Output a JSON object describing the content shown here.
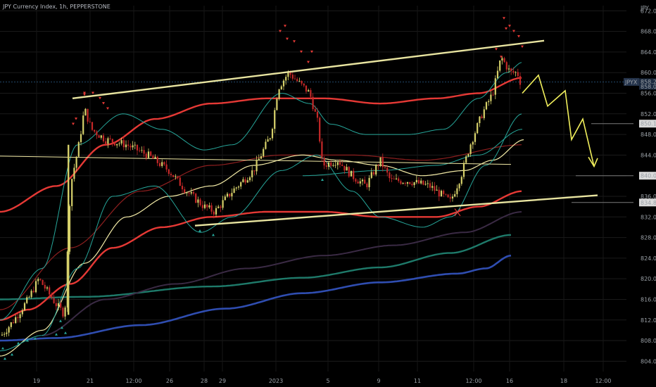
{
  "chart_data": {
    "type": "candlestick",
    "title": "JPY Currency Index, 1h, PEPPERSTONE",
    "currency": "JPY",
    "ylim": [
      802,
      873
    ],
    "y_ticks": [
      804,
      808,
      812,
      816,
      820,
      824,
      828,
      832,
      836,
      840,
      844,
      848,
      852,
      856,
      860,
      864,
      868,
      872
    ],
    "x_labels": [
      "19",
      "21",
      "12:00",
      "26",
      "28",
      "29",
      "2023",
      "5",
      "9",
      "11",
      "12:00",
      "16",
      "18",
      "12:00"
    ],
    "price_badges": [
      {
        "label": "JPYX",
        "value": "858.2",
        "kind": "symbol",
        "color": "#26354d"
      },
      {
        "value": "850.1",
        "color": "#d9d9d9"
      },
      {
        "value": "840.0",
        "color": "#d9d9d9"
      },
      {
        "value": "834.8",
        "color": "#d9d9d9"
      }
    ],
    "price_rows": [
      "858.2",
      "858.0"
    ],
    "series_colors": {
      "candle_up": "#d6d06a",
      "candle_down": "#c62828",
      "ma_red": "#e53935",
      "ma_teal": "#26a69a",
      "ma_yellow": "#f2eaa6",
      "ma_purple": "#3a2a44",
      "ma_green": "#1e7a6a",
      "ma_blue": "#2f4db0",
      "channel": "#e8e4a0",
      "projection": "#f1ef5c",
      "marker_up": "#26a69a",
      "marker_down": "#e53935"
    }
  }
}
